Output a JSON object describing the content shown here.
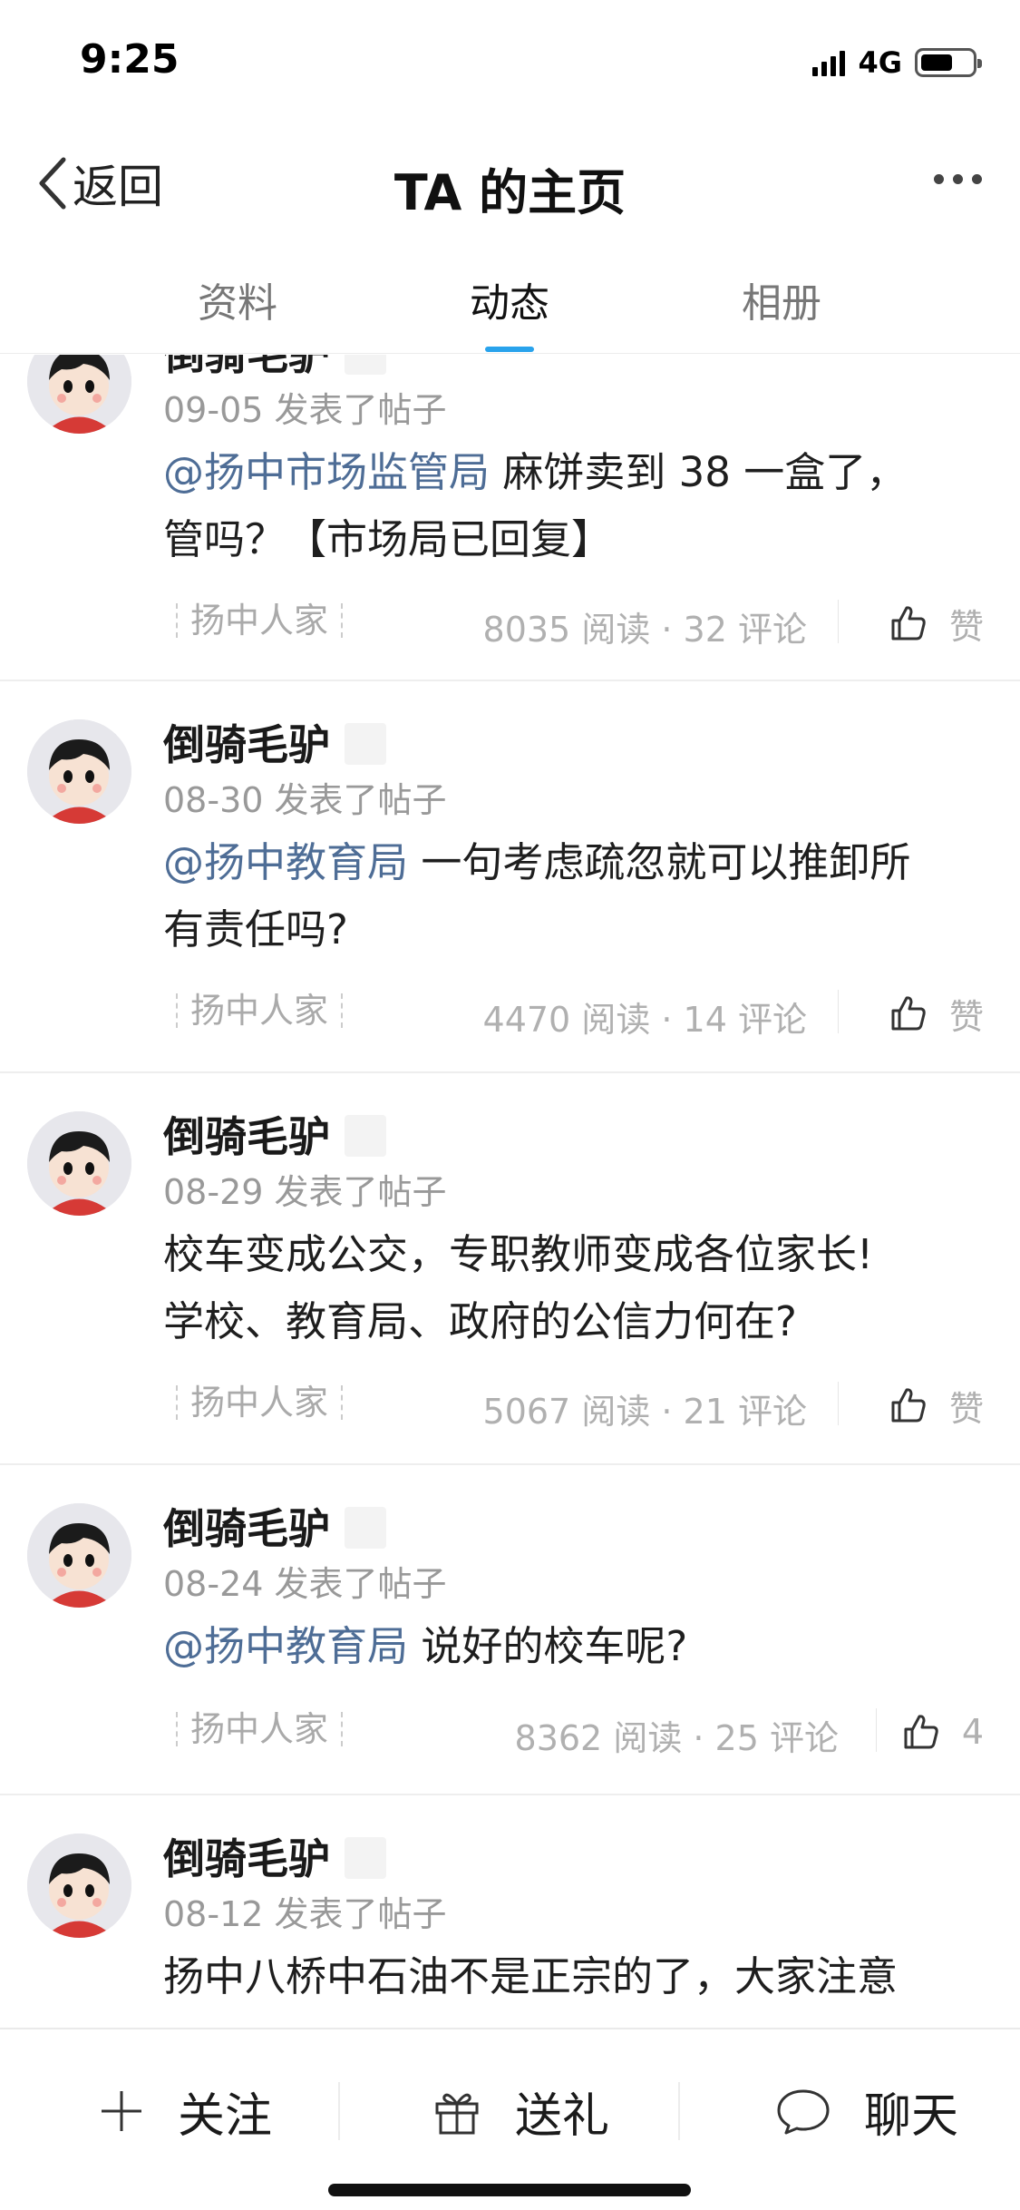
{
  "status_bar": {
    "time": "9:25",
    "network": "4G"
  },
  "nav": {
    "back_label": "返回",
    "title": "TA 的主页"
  },
  "tabs": [
    {
      "label": "资料",
      "active": false
    },
    {
      "label": "动态",
      "active": true
    },
    {
      "label": "相册",
      "active": false
    }
  ],
  "posts": [
    {
      "author": "倒骑毛驴",
      "meta": "09-05 发表了帖子",
      "mention": "@扬中市场监管局",
      "text_line1": " 麻饼卖到 38 一盒了，",
      "text_line2": "管吗？【市场局已回复】",
      "group": "扬中人家",
      "stats": "8035 阅读 · 32 评论",
      "like_label": "赞"
    },
    {
      "author": "倒骑毛驴",
      "meta": "08-30 发表了帖子",
      "mention": "@扬中教育局",
      "text_line1": " 一句考虑疏忽就可以推卸所",
      "text_line2": "有责任吗?",
      "group": "扬中人家",
      "stats": "4470 阅读 · 14 评论",
      "like_label": "赞"
    },
    {
      "author": "倒骑毛驴",
      "meta": "08-29 发表了帖子",
      "text_line1": "校车变成公交，专职教师变成各位家长!",
      "text_line2": "学校、教育局、政府的公信力何在?",
      "group": "扬中人家",
      "stats": "5067 阅读 · 21 评论",
      "like_label": "赞"
    },
    {
      "author": "倒骑毛驴",
      "meta": "08-24 发表了帖子",
      "mention": "@扬中教育局",
      "text_line1": " 说好的校车呢?",
      "group": "扬中人家",
      "stats": "8362 阅读 · 25 评论",
      "like_label": "4"
    },
    {
      "author": "倒骑毛驴",
      "meta": "08-12 发表了帖子",
      "text_line1": "扬中八桥中石油不是正宗的了，大家注意"
    }
  ],
  "bottom_bar": {
    "follow_label": "关注",
    "gift_label": "送礼",
    "chat_label": "聊天"
  },
  "icons": {
    "back": "chevron-left-icon",
    "more": "more-dots-icon",
    "like": "thumbs-up-icon",
    "follow": "plus-icon",
    "gift": "gift-icon",
    "chat": "chat-bubble-icon"
  },
  "colors": {
    "tab_underline": "#29a3ec",
    "mention": "#4e6d96"
  }
}
